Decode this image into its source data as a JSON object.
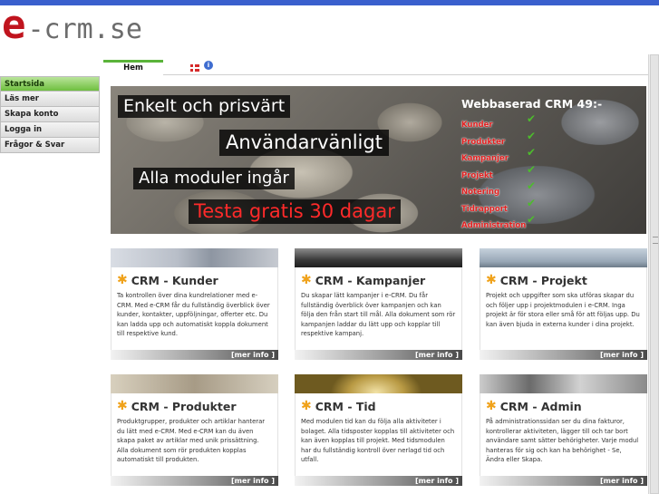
{
  "logo": {
    "e": "e",
    "rest": "-crm.se"
  },
  "sidebar": {
    "items": [
      {
        "label": "Startsida",
        "active": true
      },
      {
        "label": "Läs mer"
      },
      {
        "label": "Skapa konto"
      },
      {
        "label": "Logga in"
      },
      {
        "label": "Frågor & Svar"
      }
    ]
  },
  "tabs": {
    "home": "Hem",
    "info_icon": "i"
  },
  "hero": {
    "line1": "Enkelt och prisvärt",
    "line2": "Användarvänligt",
    "line3": "Alla moduler ingår",
    "line4": "Testa gratis 30 dagar",
    "title": "Webbaserad CRM 49:-",
    "modules": [
      "Kunder",
      "Produkter",
      "Kampanjer",
      "Projekt",
      "Notering",
      "Tidrapport",
      "Administration"
    ],
    "check": "✔"
  },
  "cards": [
    {
      "title": "CRM - Kunder",
      "text": "Ta kontrollen över dina kundrelationer med e-CRM. Med e-CRM får du fullständig överblick över kunder, kontakter, uppföljningar, offerter etc. Du kan ladda upp och automatiskt koppla dokument till respektive kund.",
      "more": "[mer info ]"
    },
    {
      "title": "CRM - Kampanjer",
      "text": "Du skapar lätt kampanjer i e-CRM. Du får fullständig överblick över kampanjen och kan följa den från start till mål. Alla dokument som rör kampanjen laddar du lätt upp och kopplar till respektive kampanj.",
      "more": "[mer info ]"
    },
    {
      "title": "CRM - Projekt",
      "text": "Projekt och uppgifter som ska utföras skapar du och följer upp i projektmodulen i e-CRM. Inga projekt är för stora eller små för att följas upp. Du kan även bjuda in externa kunder i dina projekt.",
      "more": "[mer info ]"
    },
    {
      "title": "CRM - Produkter",
      "text": "Produktgrupper, produkter och artiklar hanterar du lätt med e-CRM. Med e-CRM kan du även skapa paket av artiklar med unik prissättning. Alla dokument som rör produkten kopplas automatiskt till produkten.",
      "more": "[mer info ]"
    },
    {
      "title": "CRM - Tid",
      "text": "Med modulen tid kan du följa alla aktiviteter i bolaget. Alla tidsposter kopplas till aktiviteter och kan även kopplas till projekt. Med tidsmodulen har du fullständig kontroll över nerlagd tid och utfall.",
      "more": "[mer info ]"
    },
    {
      "title": "CRM - Admin",
      "text": "På administrationssidan ser du dina fakturor, kontrollerar aktiviteten, lägger till och tar bort användare samt sätter behörigheter. Varje modul hanteras för sig och kan ha behörighet - Se, Ändra eller Skapa.",
      "more": "[mer info ]"
    }
  ],
  "colors": {
    "brand_red": "#c0141e",
    "accent_green": "#5ab33a",
    "top_bar": "#3a5fcd"
  }
}
